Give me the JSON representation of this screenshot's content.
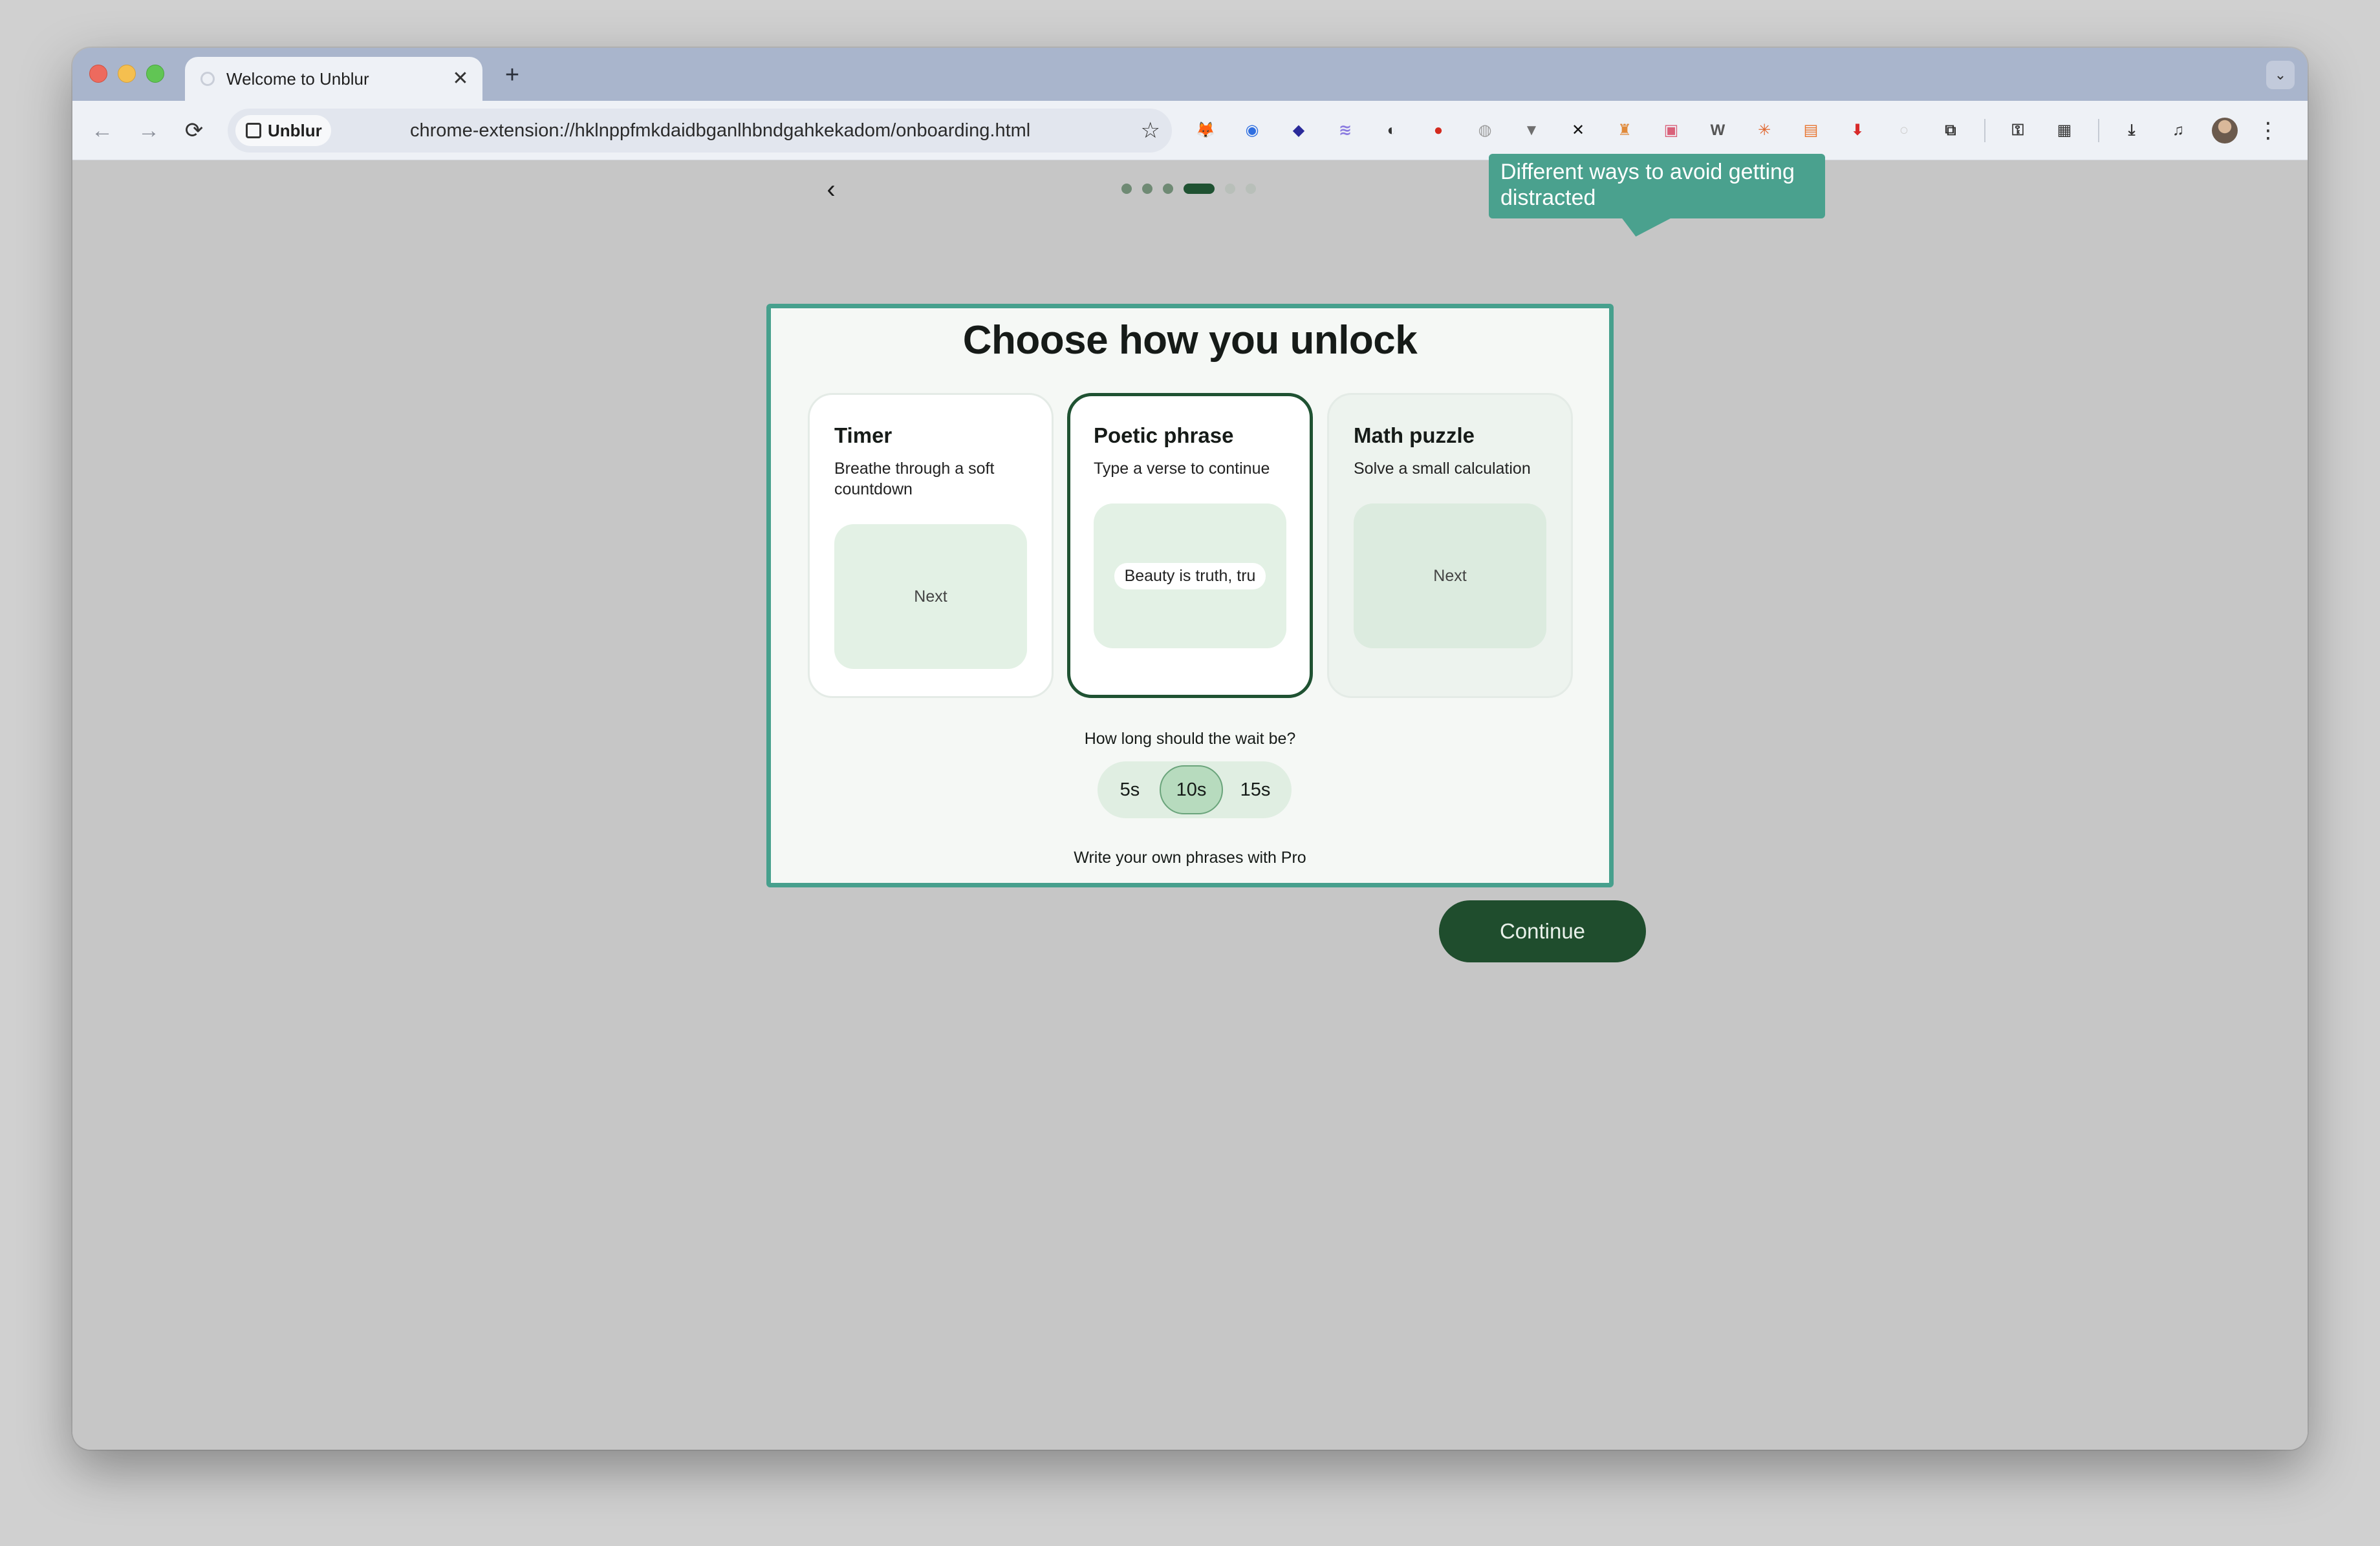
{
  "browser": {
    "tab_title": "Welcome to Unblur",
    "tab_close": "✕",
    "new_tab": "+",
    "tab_search": "⌄",
    "nav_back": "←",
    "nav_forward": "→",
    "nav_reload": "⟳",
    "site_chip": "Unblur",
    "url": "chrome-extension://hklnppfmkdaidbganlhbndgahkekadom/onboarding.html",
    "bookmark_star": "☆",
    "extensions": [
      {
        "name": "metamask-icon",
        "color": "#e2761b",
        "glyph": "🦊"
      },
      {
        "name": "blue-circle-icon",
        "color": "#2f6fe0",
        "glyph": "◉"
      },
      {
        "name": "diamond-icon",
        "color": "#2a2a9a",
        "glyph": "◆"
      },
      {
        "name": "wave-icon",
        "color": "#8a7ae0",
        "glyph": "≋"
      },
      {
        "name": "half-circle-icon",
        "color": "#333",
        "glyph": "◐"
      },
      {
        "name": "stop-icon",
        "color": "#d42a1e",
        "glyph": "●"
      },
      {
        "name": "puzzle-gray-icon",
        "color": "#9a9a9a",
        "glyph": "◍"
      },
      {
        "name": "vee-icon",
        "color": "#6f6f6f",
        "glyph": "▼"
      },
      {
        "name": "x-logo-icon",
        "color": "#111",
        "glyph": "✕"
      },
      {
        "name": "character-icon",
        "color": "#e08a3a",
        "glyph": "♜"
      },
      {
        "name": "pink-square-icon",
        "color": "#d9617a",
        "glyph": "▣"
      },
      {
        "name": "w-icon",
        "color": "#555",
        "glyph": "W"
      },
      {
        "name": "sun-icon",
        "color": "#e0662e",
        "glyph": "✳"
      },
      {
        "name": "orange-box-icon",
        "color": "#e8742e",
        "glyph": "▤"
      },
      {
        "name": "download-red-icon",
        "color": "#d82a2a",
        "glyph": "⬇"
      },
      {
        "name": "loading-icon",
        "color": "#cfcfcf",
        "glyph": "○"
      },
      {
        "name": "extensions-puzzle-icon",
        "color": "#333",
        "glyph": "⧉"
      }
    ],
    "extra_icons": [
      {
        "name": "password-key-icon",
        "glyph": "⚿"
      },
      {
        "name": "qr-code-icon",
        "glyph": "▦"
      },
      {
        "name": "download-icon",
        "glyph": "⤓"
      },
      {
        "name": "media-icon",
        "glyph": "♫"
      }
    ],
    "menu": "⋮"
  },
  "onboarding": {
    "back": "‹",
    "progress": {
      "total": 6,
      "current": 4
    },
    "tooltip": "Different ways to avoid getting distracted",
    "title": "Choose how you unlock",
    "options": [
      {
        "title": "Timer",
        "description": "Breathe through a soft countdown",
        "preview": "Next"
      },
      {
        "title": "Poetic phrase",
        "description": "Type a verse to continue",
        "preview": "Beauty is truth, tru"
      },
      {
        "title": "Math puzzle",
        "description": "Solve a small calculation",
        "preview": "Next"
      }
    ],
    "selected_option": "Poetic phrase",
    "wait_label": "How long should the wait be?",
    "wait_options": [
      "5s",
      "10s",
      "15s"
    ],
    "wait_selected": "10s",
    "pro_note": "Write your own phrases with Pro",
    "continue": "Continue"
  }
}
